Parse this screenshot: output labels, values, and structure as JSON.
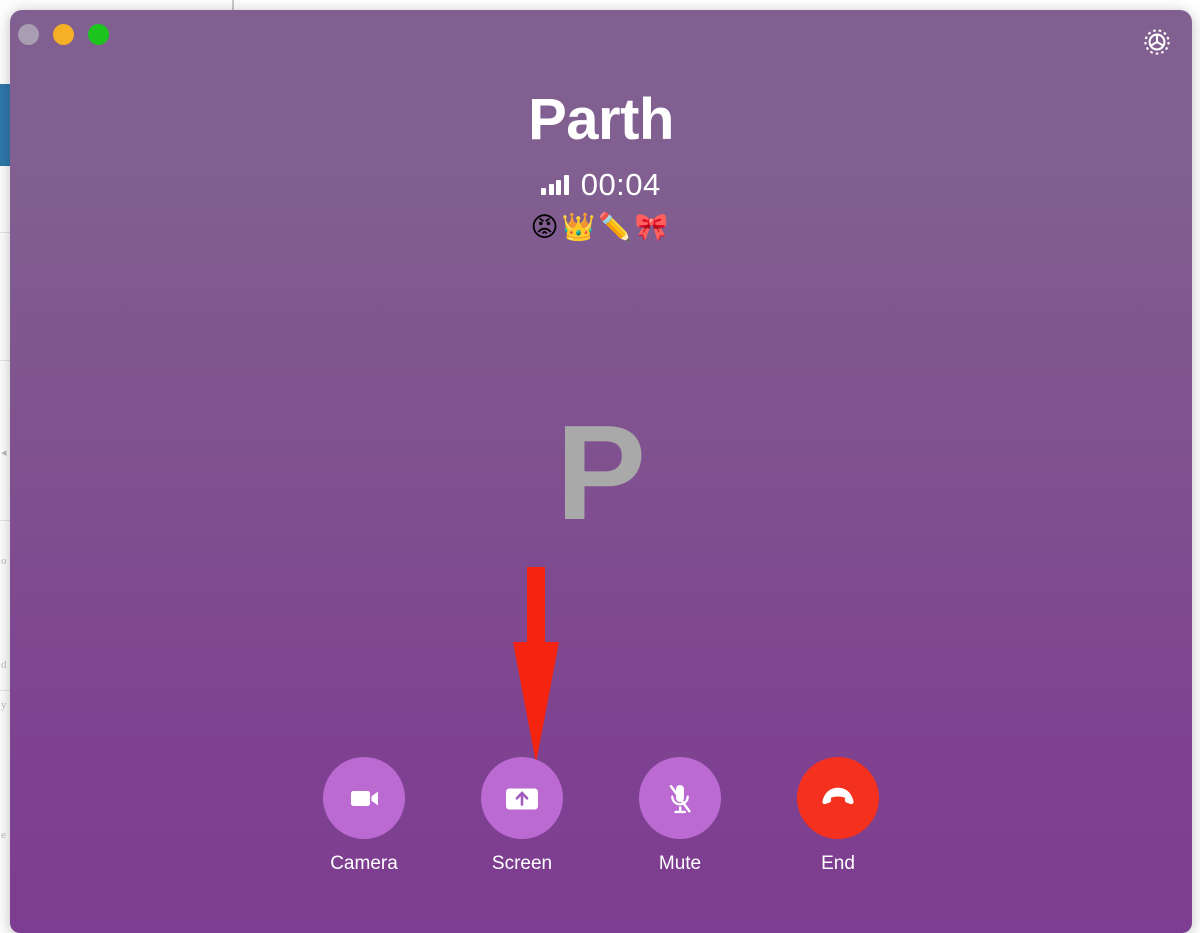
{
  "window": {
    "traffic_lights": [
      {
        "name": "close",
        "color": "#a99db2"
      },
      {
        "name": "minimize",
        "color": "#f5b025"
      },
      {
        "name": "zoom",
        "color": "#1dc41d"
      }
    ],
    "settings_icon": "gear-icon",
    "background_color_top": "#815f90",
    "background_color_bottom": "#7d3d90"
  },
  "call": {
    "contact_name": "Parth",
    "signal_icon": "signal-bars-icon",
    "signal_bars_filled": 4,
    "signal_bars_total": 4,
    "duration": "00:04",
    "emoji": "😡👑✏️🎀",
    "avatar_initial": "P",
    "avatar_color": "#a9a9a9"
  },
  "controls": [
    {
      "id": "camera",
      "label": "Camera",
      "icon": "video-camera-icon",
      "style": "normal",
      "color": "#bb6ad2"
    },
    {
      "id": "screen",
      "label": "Screen",
      "icon": "screen-share-icon",
      "style": "normal",
      "color": "#bb6ad2"
    },
    {
      "id": "mute",
      "label": "Mute",
      "icon": "microphone-muted-icon",
      "style": "normal",
      "color": "#bb6ad2"
    },
    {
      "id": "end",
      "label": "End",
      "icon": "phone-hangup-icon",
      "style": "danger",
      "color": "#f4311e"
    }
  ],
  "annotation": {
    "type": "arrow-down",
    "color": "#f42410",
    "points_to": "Screen"
  }
}
